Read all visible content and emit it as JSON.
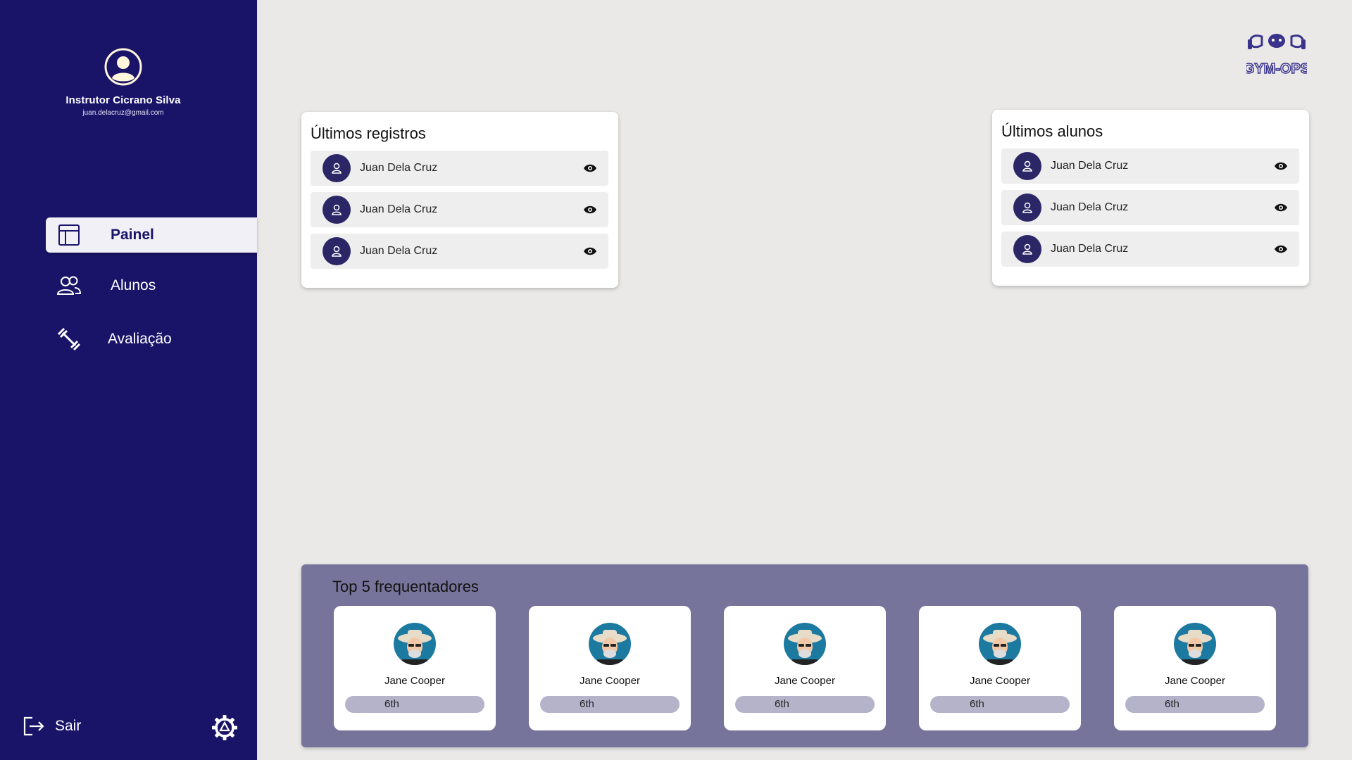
{
  "sidebar": {
    "profile": {
      "name": "Instrutor Cicrano Silva",
      "email": "juan.delacruz@gmail.com"
    },
    "nav": [
      {
        "label": "Painel",
        "icon": "dashboard-icon",
        "active": true
      },
      {
        "label": "Alunos",
        "icon": "users-icon",
        "active": false
      },
      {
        "label": "Avaliação",
        "icon": "dumbbell-icon",
        "active": false
      }
    ],
    "logout_label": "Sair",
    "settings_icon": "gear-icon"
  },
  "logo": {
    "text": "GYM-OPS"
  },
  "recent_records": {
    "title": "Últimos registros",
    "items": [
      {
        "name": "Juan Dela Cruz"
      },
      {
        "name": "Juan Dela Cruz"
      },
      {
        "name": "Juan Dela Cruz"
      }
    ]
  },
  "recent_students": {
    "title": "Últimos alunos",
    "items": [
      {
        "name": "Juan Dela Cruz"
      },
      {
        "name": "Juan Dela Cruz"
      },
      {
        "name": "Juan Dela Cruz"
      }
    ]
  },
  "top5": {
    "title": "Top 5 frequentadores",
    "items": [
      {
        "name": "Jane Cooper",
        "rank": "6th"
      },
      {
        "name": "Jane Cooper",
        "rank": "6th"
      },
      {
        "name": "Jane Cooper",
        "rank": "6th"
      },
      {
        "name": "Jane Cooper",
        "rank": "6th"
      },
      {
        "name": "Jane Cooper",
        "rank": "6th"
      }
    ]
  },
  "colors": {
    "sidebar_bg": "#1a1469",
    "page_bg": "#eae9e7",
    "panel_bg": "#77749b",
    "avatar_bg": "#2b2767",
    "rank_pill": "#b5b3c9"
  }
}
